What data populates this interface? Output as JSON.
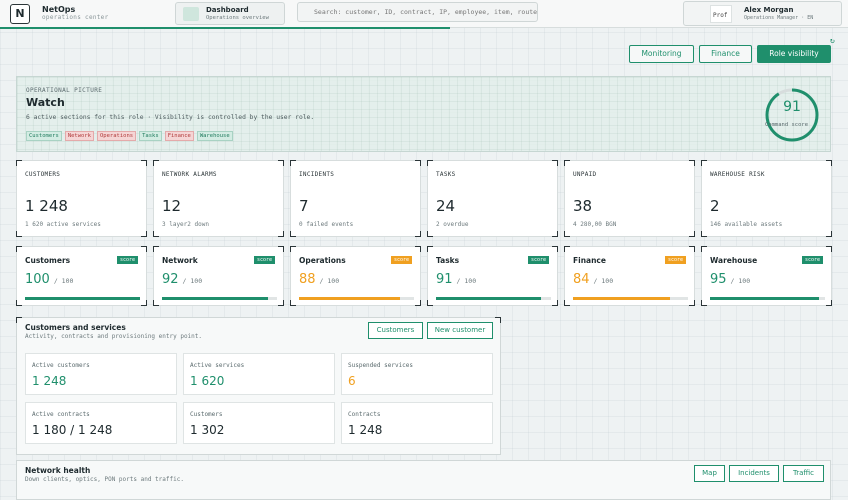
{
  "brand": {
    "logo_letter": "N",
    "name": "NetOps",
    "subtitle": "operations center"
  },
  "nav": {
    "dashboard_title": "Dashboard",
    "dashboard_sub": "Operations overview"
  },
  "search": {
    "placeholder": "Search: customer, ID, contract, IP, employee, item, router..."
  },
  "user": {
    "name": "Alex Morgan",
    "role": "Operations Manager · EN",
    "avatar_alt": "Prof"
  },
  "views": {
    "monitoring": "Monitoring",
    "finance": "Finance",
    "role_visibility": "Role visibility"
  },
  "hero": {
    "kicker": "OPERATIONAL PICTURE",
    "title": "Watch",
    "description": "6 active sections for this role · Visibility is controlled by the user role.",
    "chips": [
      {
        "label": "Customers",
        "tone": "green"
      },
      {
        "label": "Network",
        "tone": "red"
      },
      {
        "label": "Operations",
        "tone": "red"
      },
      {
        "label": "Tasks",
        "tone": "green"
      },
      {
        "label": "Finance",
        "tone": "red"
      },
      {
        "label": "Warehouse",
        "tone": "green"
      }
    ],
    "command_score": 91,
    "command_score_label": "Command score"
  },
  "kpis": [
    {
      "label": "CUSTOMERS",
      "value": "1 248",
      "sub": "1 620 active services"
    },
    {
      "label": "NETWORK ALARMS",
      "value": "12",
      "sub": "3 layer2 down"
    },
    {
      "label": "INCIDENTS",
      "value": "7",
      "sub": "0 failed events"
    },
    {
      "label": "TASKS",
      "value": "24",
      "sub": "2 overdue"
    },
    {
      "label": "UNPAID",
      "value": "38",
      "sub": "4 280,00 BGN"
    },
    {
      "label": "WAREHOUSE RISK",
      "value": "2",
      "sub": "146 available assets"
    }
  ],
  "scores": [
    {
      "label": "Customers",
      "badge": "score",
      "value": 100,
      "max": "/ 100",
      "color": "#1f8f6c"
    },
    {
      "label": "Network",
      "badge": "score",
      "value": 92,
      "max": "/ 100",
      "color": "#1f8f6c"
    },
    {
      "label": "Operations",
      "badge": "score",
      "value": 88,
      "max": "/ 100",
      "color": "#f0a020"
    },
    {
      "label": "Tasks",
      "badge": "score",
      "value": 91,
      "max": "/ 100",
      "color": "#1f8f6c"
    },
    {
      "label": "Finance",
      "badge": "score",
      "value": 84,
      "max": "/ 100",
      "color": "#f0a020"
    },
    {
      "label": "Warehouse",
      "badge": "score",
      "value": 95,
      "max": "/ 100",
      "color": "#1f8f6c"
    }
  ],
  "customers_panel": {
    "title": "Customers and services",
    "subtitle": "Activity, contracts and provisioning entry point.",
    "btn_customers": "Customers",
    "btn_new": "New customer",
    "stats": [
      {
        "label": "Active customers",
        "value": "1 248",
        "color": "#1f8f6c"
      },
      {
        "label": "Active services",
        "value": "1 620",
        "color": "#1f8f6c"
      },
      {
        "label": "Suspended services",
        "value": "6",
        "color": "#f0a020"
      },
      {
        "label": "Active contracts",
        "value": "1 180 / 1 248",
        "color": "#1e2a2e"
      },
      {
        "label": "Customers",
        "value": "1 302",
        "color": "#1e2a2e"
      },
      {
        "label": "Contracts",
        "value": "1 248",
        "color": "#1e2a2e"
      }
    ]
  },
  "network_panel": {
    "title": "Network health",
    "subtitle": "Down clients, optics, PON ports and traffic.",
    "btn_map": "Map",
    "btn_incidents": "Incidents",
    "btn_traffic": "Traffic"
  }
}
